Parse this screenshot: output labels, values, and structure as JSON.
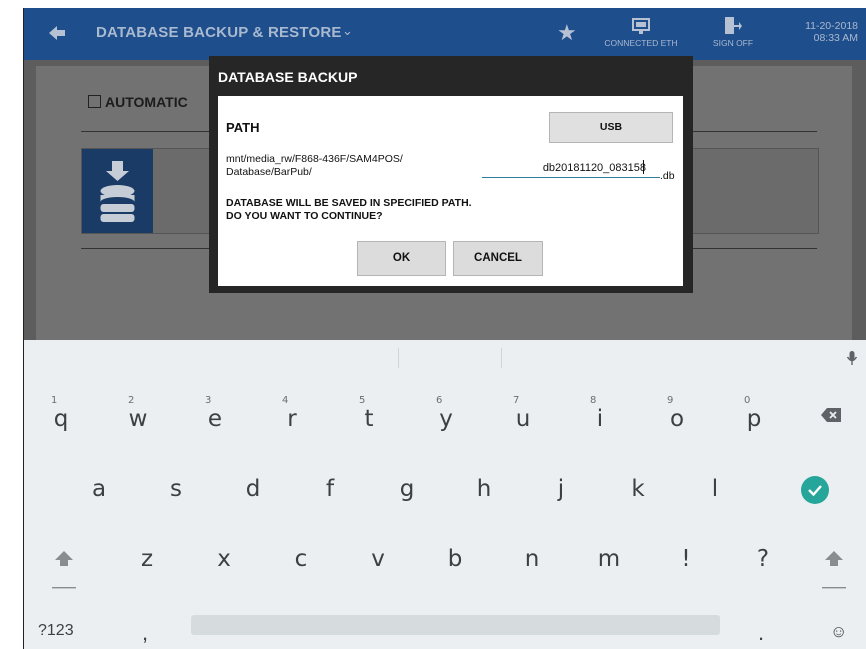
{
  "header": {
    "title": "DATABASE BACKUP & RESTORE",
    "connection_label": "CONNECTED ETH",
    "signoff_label": "SIGN OFF",
    "date": "11-20-2018",
    "time": "08:33 AM"
  },
  "background_page": {
    "automatic_label": "AUTOMATIC"
  },
  "dialog": {
    "title": "DATABASE BACKUP",
    "path_label": "PATH",
    "usb_label": "USB",
    "path_line1": "mnt/media_rw/F868-436F/SAM4POS/",
    "path_line2": "Database/BarPub/",
    "filename_value": "db20181120_083158",
    "extension": ".db",
    "message_line1": "DATABASE WILL BE SAVED IN SPECIFIED PATH.",
    "message_line2": "DO YOU WANT TO CONTINUE?",
    "ok_label": "OK",
    "cancel_label": "CANCEL"
  },
  "keyboard": {
    "row1": [
      {
        "key": "q",
        "hint": "1"
      },
      {
        "key": "w",
        "hint": "2"
      },
      {
        "key": "e",
        "hint": "3"
      },
      {
        "key": "r",
        "hint": "4"
      },
      {
        "key": "t",
        "hint": "5"
      },
      {
        "key": "y",
        "hint": "6"
      },
      {
        "key": "u",
        "hint": "7"
      },
      {
        "key": "i",
        "hint": "8"
      },
      {
        "key": "o",
        "hint": "9"
      },
      {
        "key": "p",
        "hint": "0"
      }
    ],
    "row2": [
      "a",
      "s",
      "d",
      "f",
      "g",
      "h",
      "j",
      "k",
      "l"
    ],
    "row3": [
      "z",
      "x",
      "c",
      "v",
      "b",
      "n",
      "m",
      "!",
      "?"
    ],
    "symbols_label": "?123",
    "comma": ",",
    "period": ".",
    "emoji": "☺"
  },
  "colors": {
    "header_bg": "#1f4e8c",
    "enter_key": "#26a69a",
    "db_icon_bg": "#1a3b66"
  }
}
